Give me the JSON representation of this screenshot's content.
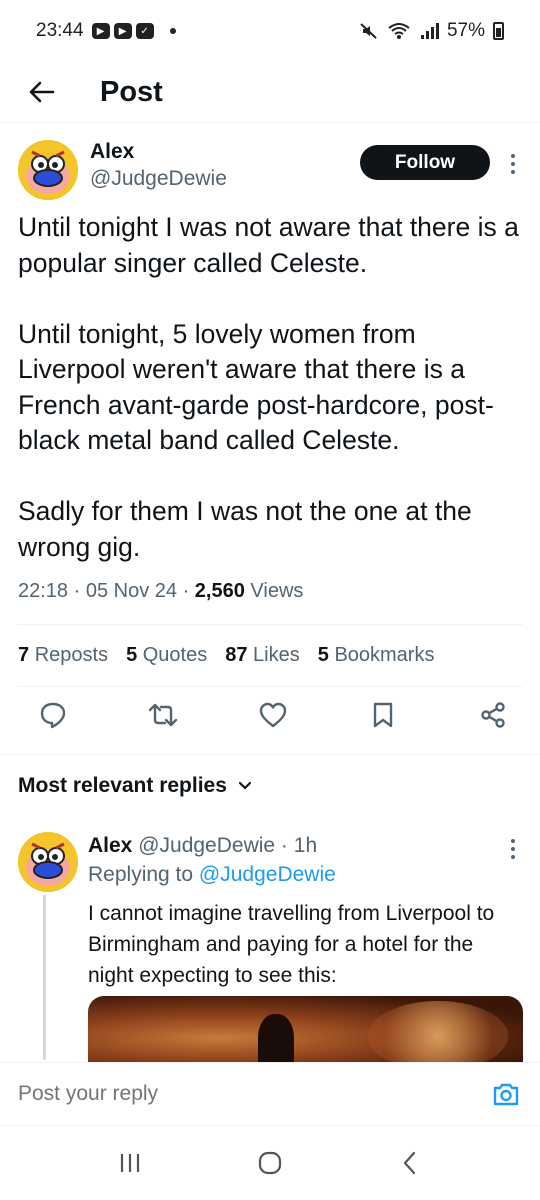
{
  "status_bar": {
    "time": "23:44",
    "battery": "57%"
  },
  "header": {
    "title": "Post"
  },
  "post": {
    "author_name": "Alex",
    "author_handle": "@JudgeDewie",
    "follow_label": "Follow",
    "paragraphs": [
      "Until tonight I was not aware that there is a popular singer called Celeste.",
      "Until tonight, 5 lovely women from Liverpool weren't aware that there is a French avant-garde post-hardcore, post-black metal band called Celeste.",
      "Sadly for them I was not the one at the wrong gig."
    ],
    "time": "22:18",
    "date": "05 Nov 24",
    "views_count": "2,560",
    "views_label": "Views",
    "stats": [
      {
        "count": "7",
        "label": "Reposts"
      },
      {
        "count": "5",
        "label": "Quotes"
      },
      {
        "count": "87",
        "label": "Likes"
      },
      {
        "count": "5",
        "label": "Bookmarks"
      }
    ],
    "actions": [
      "reply-icon",
      "repost-icon",
      "like-icon",
      "bookmark-icon",
      "share-icon"
    ]
  },
  "replies": {
    "heading": "Most relevant replies",
    "items": [
      {
        "author_name": "Alex",
        "author_handle": "@JudgeDewie",
        "age": "1h",
        "replying_prefix": "Replying to",
        "replying_to": "@JudgeDewie",
        "text": "I cannot imagine travelling from Liverpool to Birmingham and paying for a hotel for the night expecting to see this:"
      }
    ]
  },
  "composer": {
    "placeholder": "Post your reply"
  },
  "colors": {
    "accent": "#1d9bf0",
    "text": "#0f1419",
    "secondary": "#536471",
    "divider": "#eff3f4"
  }
}
